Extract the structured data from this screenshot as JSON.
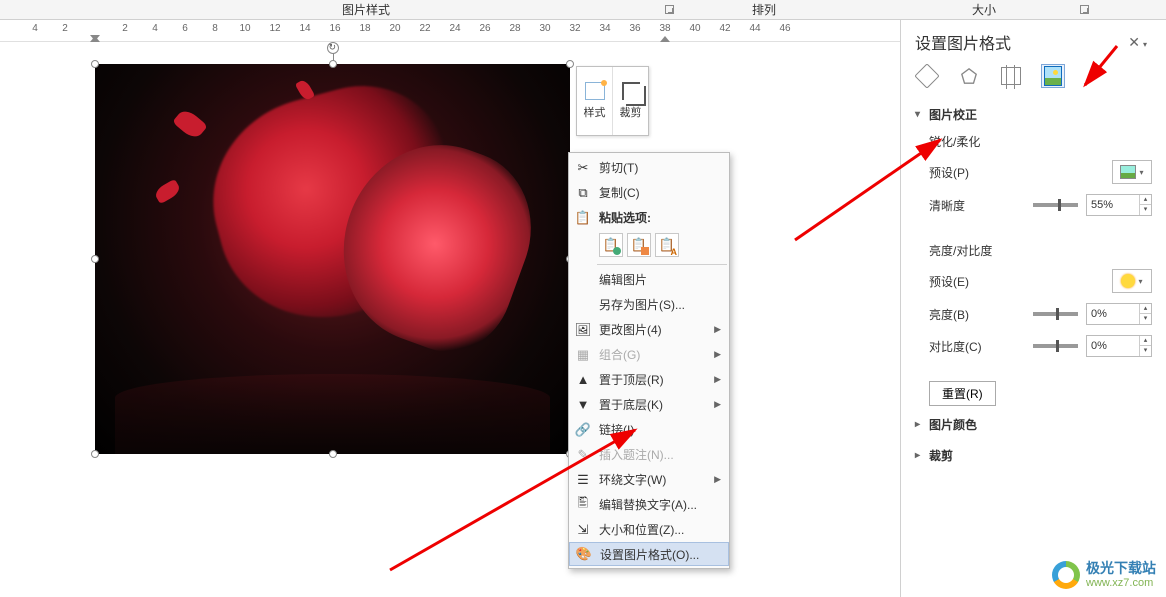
{
  "ribbon": {
    "pic_style": "图片样式",
    "arrange": "排列",
    "size": "大小"
  },
  "ruler": {
    "numbers": [
      -4,
      -2,
      2,
      4,
      6,
      8,
      10,
      12,
      14,
      16,
      18,
      20,
      22,
      24,
      26,
      28,
      30,
      32,
      34,
      36,
      38,
      40,
      42,
      44,
      46
    ]
  },
  "mini_toolbar": {
    "style": "样式",
    "crop": "裁剪"
  },
  "context_menu": {
    "cut": "剪切(T)",
    "copy": "复制(C)",
    "paste_options": "粘贴选项:",
    "edit_picture": "编辑图片",
    "save_as_picture": "另存为图片(S)...",
    "change_picture": "更改图片(4)",
    "group": "组合(G)",
    "bring_front": "置于顶层(R)",
    "send_back": "置于底层(K)",
    "link": "链接(I)",
    "insert_caption": "插入题注(N)...",
    "wrap_text": "环绕文字(W)",
    "edit_alt": "编辑替换文字(A)...",
    "size_position": "大小和位置(Z)...",
    "format_picture": "设置图片格式(O)..."
  },
  "panel": {
    "title": "设置图片格式",
    "sections": {
      "correction": "图片校正",
      "sharpen_soften": "锐化/柔化",
      "preset_p": "预设(P)",
      "sharpness": "清晰度",
      "sharpness_value": "55%",
      "brightness_contrast": "亮度/对比度",
      "preset_e": "预设(E)",
      "brightness": "亮度(B)",
      "brightness_value": "0%",
      "contrast": "对比度(C)",
      "contrast_value": "0%",
      "reset": "重置(R)",
      "picture_color": "图片颜色",
      "crop": "裁剪"
    }
  },
  "watermark": {
    "cn": "极光下载站",
    "url": "www.xz7.com"
  },
  "chart_data": null
}
